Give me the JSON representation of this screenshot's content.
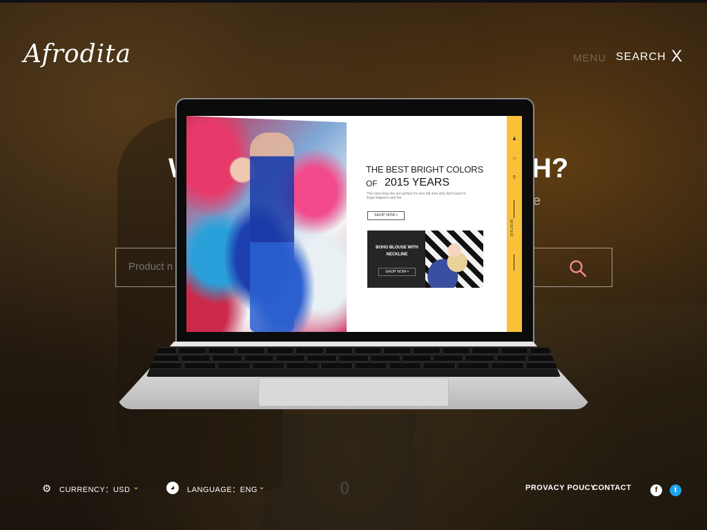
{
  "header": {
    "logo": "Afrodita",
    "menu_label": "MENU",
    "search_label": "SEARCH",
    "close_label": "X"
  },
  "search": {
    "heading_left": "W",
    "heading_right": "H?",
    "sub_right": "e",
    "placeholder": "Product n"
  },
  "screen": {
    "title_line1": "THE BEST BRIGHT COLORS",
    "title_of": "OF",
    "title_year": "2015 YEARS",
    "description": "The extra long tiec are perfect for very tall men who don't want to forgo leligance and the",
    "shop_now_1": "SHOP NOW",
    "promo_title": "BOHO BLOUSE WITH NECKLINE",
    "shop_now_2": "SHOP NOW",
    "side_winter": "WINTER"
  },
  "footer": {
    "currency_label": "CURRENCY：USD",
    "language_label": "LANGUAGE：ENG",
    "privacy": "PROVACY POUCY",
    "contact": "CONTACT",
    "mid_glyph": "0"
  },
  "colors": {
    "accent_yellow": "#f9c13a",
    "search_icon": "#f08a9a",
    "facebook": "#ffffff",
    "twitter": "#1da1f2"
  }
}
